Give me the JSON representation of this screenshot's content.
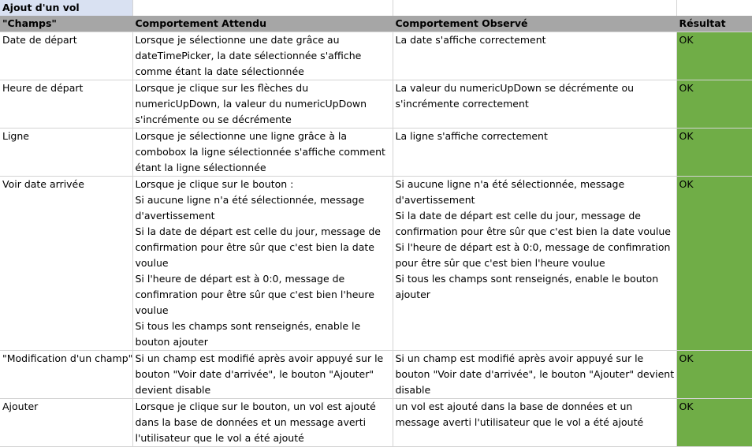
{
  "sheet_title": "Ajout d'un vol",
  "headers": [
    "\"Champs\"",
    "Comportement Attendu",
    "Comportement Observé",
    "Résultat"
  ],
  "rows": [
    {
      "champ": "Date de départ",
      "attendu": "Lorsque je sélectionne une date grâce au dateTimePicker, la date sélectionnée s'affiche comme étant la date sélectionnée",
      "observe": "La date s'affiche correctement",
      "resultat": "OK"
    },
    {
      "champ": "Heure de départ",
      "attendu": "Lorsque je clique sur les flèches du numericUpDown, la valeur du numericUpDown s'incrémente ou se décrémente",
      "observe": "La valeur du numericUpDown se décrémente ou s'incrémente correctement",
      "resultat": "OK"
    },
    {
      "champ": "Ligne",
      "attendu": "Lorsque je sélectionne une ligne grâce à la combobox la ligne sélectionnée s'affiche comment étant la ligne sélectionnée",
      "observe": "La ligne s'affiche correctement",
      "resultat": "OK"
    },
    {
      "champ": "Voir date arrivée",
      "attendu": "Lorsque je clique sur le bouton  :\nSi aucune ligne n'a été sélectionnée, message d'avertissement\nSi la date de départ est celle du jour, message de confirmation pour être sûr que c'est bien la date voulue\nSi l'heure de départ est à 0:0, message de confimration pour être sûr que c'est bien l'heure voulue\nSi tous les champs sont renseignés, enable le bouton ajouter",
      "observe": "Si aucune ligne n'a été sélectionnée, message d'avertissement\nSi la date de départ est celle du jour, message de confirmation pour être sûr que c'est bien la date voulue\nSi l'heure de départ est à 0:0, message de confimration pour être sûr que c'est bien l'heure voulue\nSi tous les champs sont renseignés, enable le bouton ajouter",
      "resultat": "OK"
    },
    {
      "champ": "\"Modification d'un champ\"",
      "attendu": "Si un champ est modifié après avoir appuyé sur le bouton \"Voir date d'arrivée\", le bouton \"Ajouter\" devient disable",
      "observe": "Si un champ est modifié après avoir appuyé sur le bouton \"Voir date d'arrivée\", le bouton \"Ajouter\" devient disable",
      "resultat": "OK"
    },
    {
      "champ": "Ajouter",
      "attendu": "Lorsque je clique sur le bouton, un vol est ajouté dans la base de données et un message averti l'utilisateur que le vol a été ajouté",
      "observe": "un vol est ajouté dans la base de données et un message averti l'utilisateur que le vol a été ajouté",
      "resultat": "OK"
    }
  ]
}
